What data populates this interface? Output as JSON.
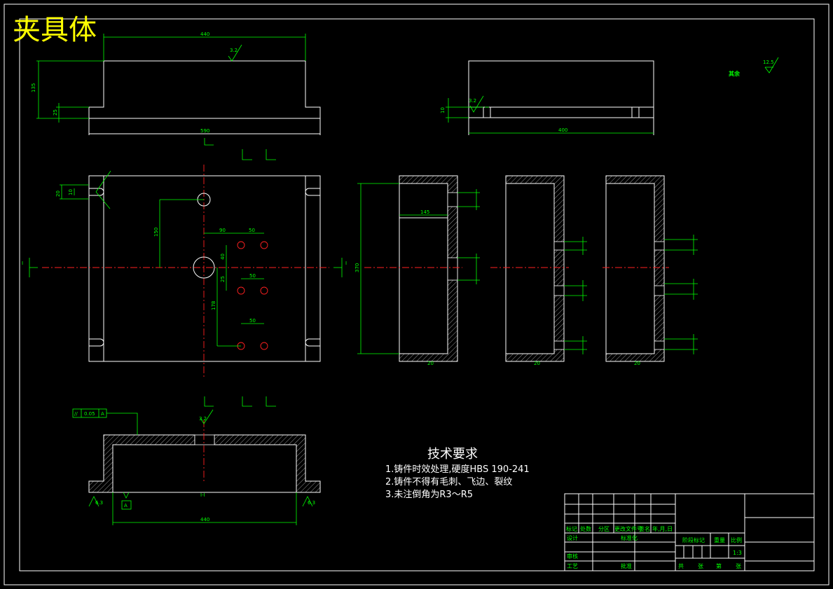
{
  "title": "夹具体",
  "roughness_note": {
    "label": "其余",
    "value": "12.5"
  },
  "roughness_symbols": [
    "3.2",
    "3.2",
    "3.2",
    "6.3",
    "6.3"
  ],
  "tech_requirements": {
    "heading": "技术要求",
    "items": [
      "1.铸件时效处理,硬度HBS 190-241",
      "2.铸件不得有毛刺、飞边、裂纹",
      "3.未注倒角为R3～R5"
    ]
  },
  "dimensions": {
    "top_view_width": "440",
    "top_view_height": "135",
    "top_view_step": "25",
    "top_view_base": "590",
    "side_view_width": "400",
    "side_view_step": "10",
    "plan_150": "150",
    "plan_90": "90",
    "plan_50_a": "50",
    "plan_40": "40",
    "plan_50_b": "50",
    "plan_25": "25",
    "plan_178": "178",
    "plan_50_c": "50",
    "plan_slot_20": "20",
    "plan_slot_10": "10",
    "section_height": "370",
    "section_145": "145",
    "section_depth": "20",
    "bottom_width": "440"
  },
  "section_labels": {
    "i_left": "I",
    "i_right": "I",
    "bottom_view": "I-I"
  },
  "tolerance_frame": {
    "symbol": "//",
    "value": "0.05",
    "datum": "A"
  },
  "datum_label": "A",
  "title_block": {
    "header_row": [
      "标记",
      "处数",
      "分区",
      "更改文件号",
      "签名",
      "年,月,日"
    ],
    "design": "设计",
    "standardize": "标准化",
    "check": "审核",
    "process": "工艺",
    "approve": "批准",
    "stage_mark": "阶段标记",
    "weight": "重量",
    "scale_label": "比例",
    "scale": "1:3",
    "total_sheets": "共",
    "sheet_unit": "张",
    "sheet_no": "第",
    "sheet_unit2": "张"
  }
}
